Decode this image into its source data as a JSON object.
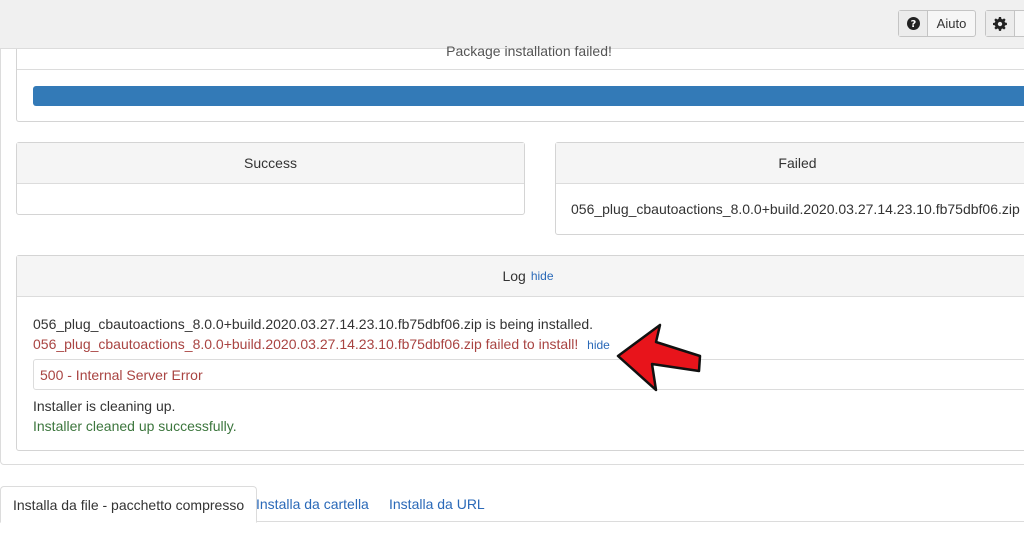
{
  "toolbar": {
    "help_label": "Aiuto",
    "help_icon": "question-circle-icon",
    "options_icon": "gear-icon"
  },
  "progress": {
    "title": "Package installation failed!",
    "fraction": 1.0,
    "bar_color": "#337ab7"
  },
  "success": {
    "title": "Success"
  },
  "failed": {
    "title": "Failed",
    "items": [
      "056_plug_cbautoactions_8.0.0+build.2020.03.27.14.23.10.fb75dbf06.zip"
    ]
  },
  "log": {
    "title": "Log",
    "hide_label": "hide",
    "line1": "056_plug_cbautoactions_8.0.0+build.2020.03.27.14.23.10.fb75dbf06.zip is being installed.",
    "line2": "056_plug_cbautoactions_8.0.0+build.2020.03.27.14.23.10.fb75dbf06.zip failed to install!",
    "line2_hide": "hide",
    "error_text": "500 - Internal Server Error",
    "line3": "Installer is cleaning up.",
    "line4": "Installer cleaned up successfully."
  },
  "tabs": [
    {
      "label": "Installa da file - pacchetto compresso",
      "active": true
    },
    {
      "label": "Installa da cartella",
      "active": false
    },
    {
      "label": "Installa da URL",
      "active": false
    }
  ],
  "colors": {
    "error": "#a94442",
    "success": "#3c763d",
    "link": "#2a69b8",
    "annotation_arrow": "#e8141b"
  }
}
